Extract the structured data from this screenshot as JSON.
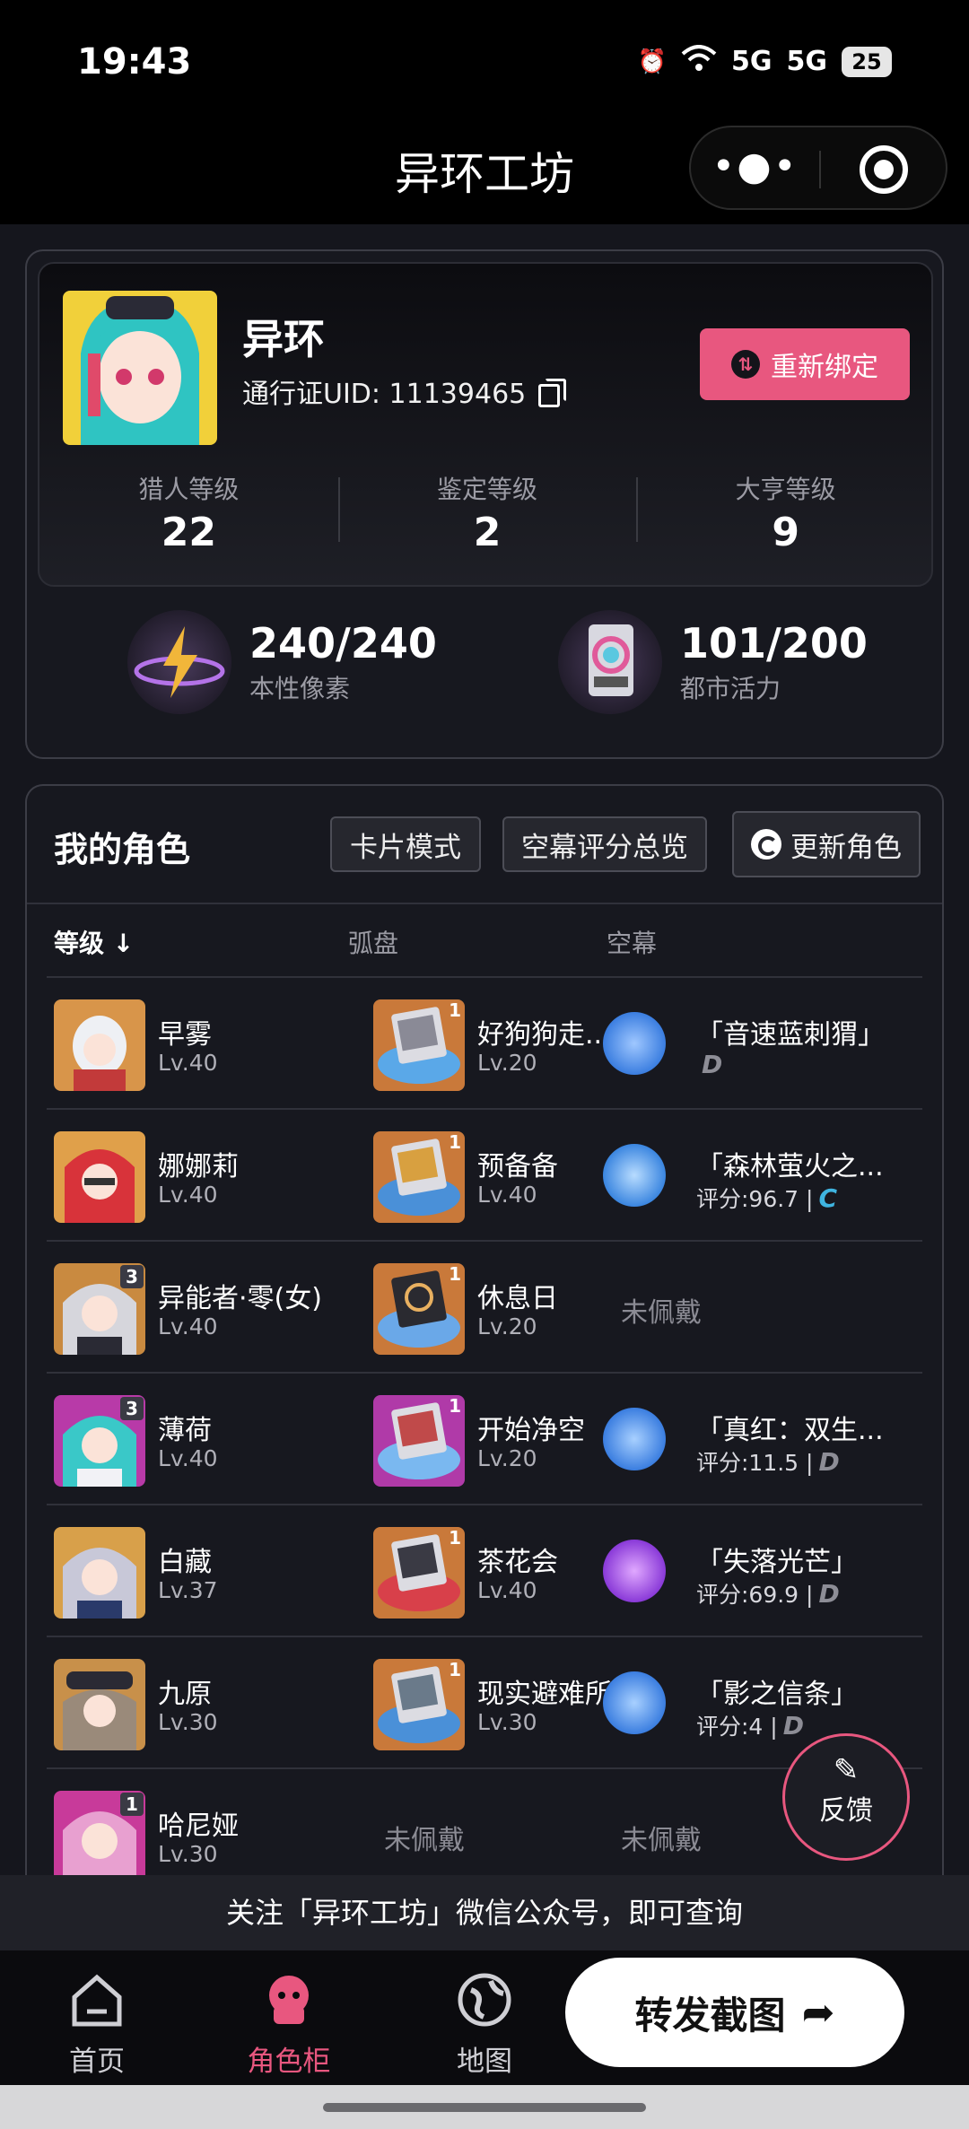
{
  "status": {
    "time": "19:43",
    "signal1": "5G",
    "signal2": "5G",
    "battery": "25"
  },
  "header": {
    "title": "异环工坊"
  },
  "profile": {
    "name": "异环",
    "uid_label": "通行证UID: 11139465",
    "rebind_label": "重新绑定",
    "levels": [
      {
        "label": "猎人等级",
        "value": "22"
      },
      {
        "label": "鉴定等级",
        "value": "2"
      },
      {
        "label": "大亨等级",
        "value": "9"
      }
    ],
    "resources": [
      {
        "value": "240/240",
        "label": "本性像素"
      },
      {
        "value": "101/200",
        "label": "都市活力"
      }
    ]
  },
  "roles": {
    "title": "我的角色",
    "tabs": {
      "card_mode": "卡片模式",
      "overview": "空幕评分总览",
      "refresh": "更新角色"
    },
    "columns": {
      "level": "等级 ↓",
      "disc": "弧盘",
      "sky": "空幕"
    },
    "unequipped": "未佩戴",
    "rows": [
      {
        "name": "早雾",
        "level": "Lv.40",
        "badge": "",
        "disc": "好狗狗走...",
        "disc_level": "Lv.20",
        "disc_badge": "1",
        "sky": "「音速蓝刺猬」",
        "score": "",
        "grade": "D"
      },
      {
        "name": "娜娜莉",
        "level": "Lv.40",
        "badge": "",
        "disc": "预备备",
        "disc_level": "Lv.40",
        "disc_badge": "1",
        "sky": "「森林萤火之...",
        "score": "评分:96.7 |",
        "grade": "C"
      },
      {
        "name": "异能者·零(女)",
        "level": "Lv.40",
        "badge": "3",
        "disc": "休息日",
        "disc_level": "Lv.20",
        "disc_badge": "1",
        "sky": "",
        "score": "",
        "grade": ""
      },
      {
        "name": "薄荷",
        "level": "Lv.40",
        "badge": "3",
        "disc": "开始净空",
        "disc_level": "Lv.20",
        "disc_badge": "1",
        "sky": "「真红：双生...",
        "score": "评分:11.5 |",
        "grade": "D"
      },
      {
        "name": "白藏",
        "level": "Lv.37",
        "badge": "",
        "disc": "茶花会",
        "disc_level": "Lv.40",
        "disc_badge": "1",
        "sky": "「失落光芒」",
        "score": "评分:69.9 |",
        "grade": "D"
      },
      {
        "name": "九原",
        "level": "Lv.30",
        "badge": "",
        "disc": "现实避难所",
        "disc_level": "Lv.30",
        "disc_badge": "1",
        "sky": "「影之信条」",
        "score": "评分:4 |",
        "grade": "D"
      },
      {
        "name": "哈尼娅",
        "level": "Lv.30",
        "badge": "1",
        "disc": "",
        "disc_level": "",
        "disc_badge": "",
        "sky": "",
        "score": "",
        "grade": ""
      }
    ]
  },
  "feedback": {
    "label": "反馈"
  },
  "notice": "关注「异环工坊」微信公众号，即可查询",
  "nav": {
    "home": "首页",
    "roles": "角色柜",
    "map": "地图",
    "share": "转发截图"
  },
  "colors": {
    "accent": "#e8577f",
    "panel": "#17181f",
    "background": "#15161d"
  }
}
